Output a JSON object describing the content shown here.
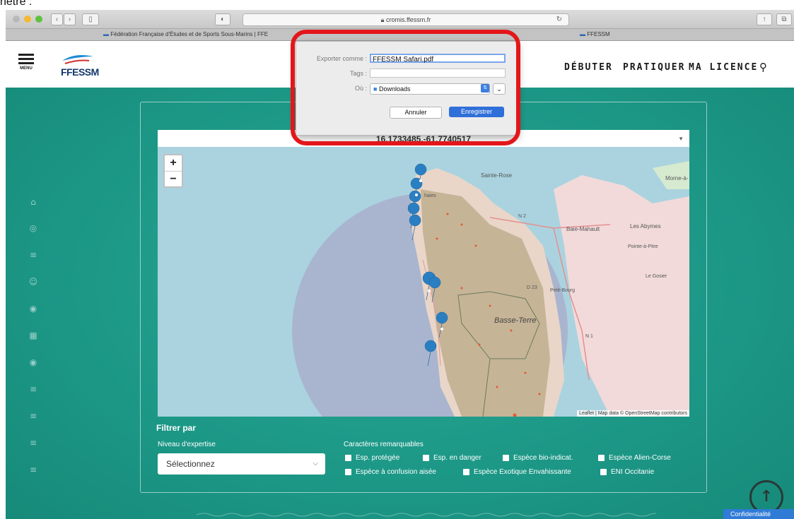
{
  "doc_caption": "nêtre :",
  "browser": {
    "url": "cromis.ffessm.fr",
    "tabs": [
      "Fédération Française d'Études et de Sports Sous-Marins | FFE",
      "FFESSM"
    ]
  },
  "header": {
    "menu_label": "MENU",
    "logo_text": "FFESSM",
    "nav": [
      "DÉBUTER",
      "PRATIQUER",
      "MA LICENCE"
    ]
  },
  "map": {
    "coordinates": "16.1733485,-61.7740517",
    "zoom_in": "+",
    "zoom_out": "−",
    "labels": {
      "sainte_rose": "Sainte-Rose",
      "morne": "Morne-à-",
      "baie_mahault": "Baie-Mahault",
      "abymes": "Les Abymes",
      "pointe": "Pointe-à-Pitre",
      "gosier": "Le Gosier",
      "petit_bourg": "Petit-Bourg",
      "basse_terre": "Basse-Terre",
      "n2": "N 2",
      "n1": "N 1",
      "d23": "D 23",
      "deshaies": "haies"
    },
    "attribution": "Leaflet | Map data © OpenStreetMap contributors"
  },
  "filters": {
    "title": "Filtrer par",
    "expertise_label": "Niveau d'expertise",
    "expertise_value": "Sélectionnez",
    "traits_label": "Caractères remarquables",
    "checkboxes": [
      "Esp. protégée",
      "Esp. en danger",
      "Espèce bio-indicat.",
      "Espèce Alien-Corse",
      "Espèce à confusion aisée",
      "Espèce Exotique Envahissante",
      "ENI Occitanie"
    ]
  },
  "footer": {
    "privacy": "Confidentialité"
  },
  "dialog": {
    "export_label": "Exporter comme :",
    "export_value": "FFESSM Safari.pdf",
    "tags_label": "Tags :",
    "where_label": "Où :",
    "where_value": "Downloads",
    "cancel": "Annuler",
    "save": "Enregistrer"
  },
  "colors": {
    "teal": "#1f9b8a",
    "highlight": "#e3161a",
    "marker": "#2a7fc2",
    "primary_button": "#2f6fd9"
  }
}
